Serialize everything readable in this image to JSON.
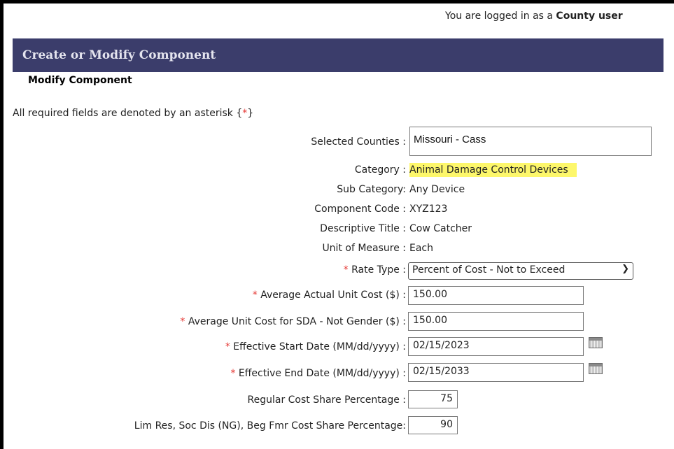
{
  "header": {
    "login_prefix": "You are logged in as a ",
    "login_role": "County user"
  },
  "banner": {
    "title": "Create or Modify Component"
  },
  "subheading": "Modify Component",
  "required_note": {
    "prefix": "All required fields are denoted by an asterisk {",
    "star": "*",
    "suffix": "}"
  },
  "asterisk": "*",
  "fields": {
    "selected_counties": {
      "label": "Selected Counties :",
      "value": "Missouri - Cass"
    },
    "category": {
      "label": "Category :",
      "value": "Animal Damage Control Devices"
    },
    "sub_category": {
      "label": "Sub Category:",
      "value": "Any Device"
    },
    "component_code": {
      "label": "Component Code :",
      "value": "XYZ123"
    },
    "descriptive_title": {
      "label": "Descriptive Title :",
      "value": "Cow Catcher"
    },
    "unit_of_measure": {
      "label": "Unit of Measure :",
      "value": "Each"
    },
    "rate_type": {
      "label": "Rate Type :",
      "value": "Percent of Cost - Not to Exceed"
    },
    "avg_unit_cost": {
      "label": "Average Actual Unit Cost ($) :",
      "value": "150.00"
    },
    "avg_unit_cost_sda": {
      "label": "Average Unit Cost for SDA - Not Gender ($) :",
      "value": "150.00"
    },
    "start_date": {
      "label": "Effective Start Date (MM/dd/yyyy) :",
      "value": "02/15/2023"
    },
    "end_date": {
      "label": "Effective End Date (MM/dd/yyyy) :",
      "value": "02/15/2033"
    },
    "regular_pct": {
      "label": "Regular Cost Share Percentage :",
      "value": "75"
    },
    "limres_pct": {
      "label": "Lim Res, Soc Dis (NG), Beg Fmr Cost Share Percentage:",
      "value": "90"
    }
  },
  "icons": {
    "calendar": "calendar-icon",
    "dropdown": "chevron-down-icon"
  }
}
